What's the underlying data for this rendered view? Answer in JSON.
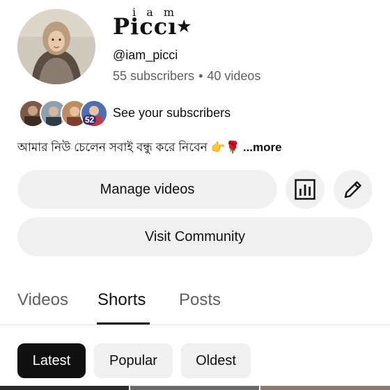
{
  "channel": {
    "name_top": "i a m",
    "name_main": "Piccı",
    "name_star": "★",
    "handle": "@iam_picci",
    "subscribers": "55 subscribers",
    "separator": "•",
    "videos": "40 videos",
    "avatar_icon": "profile-photo"
  },
  "subscribers_row": {
    "label": "See your subscribers",
    "badge": "52"
  },
  "description": {
    "text": "আমার নিউ চেলেন সবাই বন্ধু করে নিবেন 👉🌹",
    "more": "...more"
  },
  "actions": {
    "manage_videos": "Manage videos",
    "visit_community": "Visit Community",
    "analytics_icon": "bar-chart-icon",
    "edit_icon": "pencil-icon"
  },
  "tabs": [
    {
      "label": "Videos",
      "active": false
    },
    {
      "label": "Shorts",
      "active": true
    },
    {
      "label": "Posts",
      "active": false
    }
  ],
  "chips": [
    {
      "label": "Latest",
      "active": true
    },
    {
      "label": "Popular",
      "active": false
    },
    {
      "label": "Oldest",
      "active": false
    }
  ],
  "colors": {
    "text_primary": "#0f0f0f",
    "text_secondary": "#606060",
    "button_bg": "#f0f0f0",
    "chip_active_bg": "#0f0f0f"
  }
}
